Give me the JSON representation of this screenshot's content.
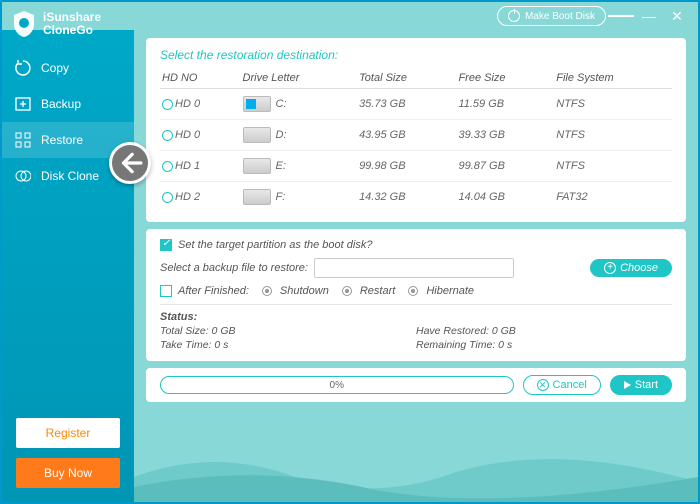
{
  "app": {
    "title1": "iSunshare",
    "title2": "CloneGo"
  },
  "titlebar": {
    "boot": "Make Boot Disk"
  },
  "nav": [
    {
      "label": "Copy"
    },
    {
      "label": "Backup"
    },
    {
      "label": "Restore"
    },
    {
      "label": "Disk Clone"
    }
  ],
  "side": {
    "register": "Register",
    "buy": "Buy Now"
  },
  "panel1": {
    "title": "Select the restoration destination:",
    "headers": {
      "hdno": "HD NO",
      "drive": "Drive Letter",
      "total": "Total Size",
      "free": "Free Size",
      "fs": "File System"
    },
    "rows": [
      {
        "hd": "HD 0",
        "letter": "C:",
        "total": "35.73 GB",
        "free": "11.59 GB",
        "fs": "NTFS",
        "icon": "win"
      },
      {
        "hd": "HD 0",
        "letter": "D:",
        "total": "43.95 GB",
        "free": "39.33 GB",
        "fs": "NTFS",
        "icon": ""
      },
      {
        "hd": "HD 1",
        "letter": "E:",
        "total": "99.98 GB",
        "free": "99.87 GB",
        "fs": "NTFS",
        "icon": ""
      },
      {
        "hd": "HD 2",
        "letter": "F:",
        "total": "14.32 GB",
        "free": "14.04 GB",
        "fs": "FAT32",
        "icon": ""
      }
    ]
  },
  "panel2": {
    "boot_check": "Set the target partition as the boot disk?",
    "select_label": "Select a backup file to restore:",
    "choose": "Choose",
    "after": "After Finished:",
    "opts": {
      "shutdown": "Shutdown",
      "restart": "Restart",
      "hibernate": "Hibernate"
    },
    "status_label": "Status:",
    "total": "Total Size: 0 GB",
    "restored": "Have Restored: 0 GB",
    "take": "Take Time: 0 s",
    "remain": "Remaining Time: 0 s"
  },
  "footer": {
    "pct": "0%",
    "cancel": "Cancel",
    "start": "Start"
  }
}
